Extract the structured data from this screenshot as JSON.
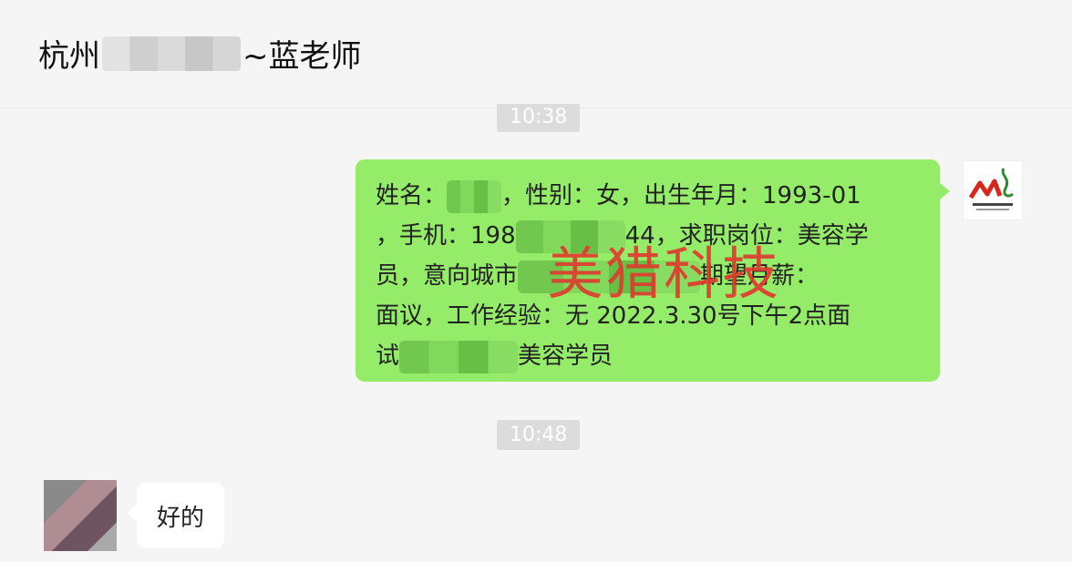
{
  "window": {
    "title_prefix": "杭州",
    "title_suffix": "~蓝老师",
    "pin_glyph": "⚲",
    "minimize_glyph": "—",
    "maximize_glyph": "☐",
    "close_glyph": "✕",
    "more_glyph": "···",
    "icons": [
      "pin-icon",
      "minimize-icon",
      "maximize-icon",
      "close-icon",
      "more-icon"
    ]
  },
  "messages": [
    {
      "timestamp": "10:38",
      "sender": "me",
      "lines": [
        [
          "姓名：",
          "，性别：女，出生年月：1993-01"
        ],
        [
          "，手机：198",
          "44，求职岗位：美容学"
        ],
        [
          "员，意向城市",
          "期望月薪："
        ],
        [
          "面议，工作经验：无 2022.3.30号下午2点面"
        ],
        [
          "试",
          "美容学员"
        ]
      ],
      "watermark": "美猎科技",
      "avatar_logo_text": "美猎科技"
    },
    {
      "timestamp": "10:48",
      "sender": "other",
      "text": "好的"
    }
  ],
  "colors": {
    "bubble_me": "#95ec69",
    "bubble_other": "#ffffff",
    "watermark": "#e03b2f"
  }
}
